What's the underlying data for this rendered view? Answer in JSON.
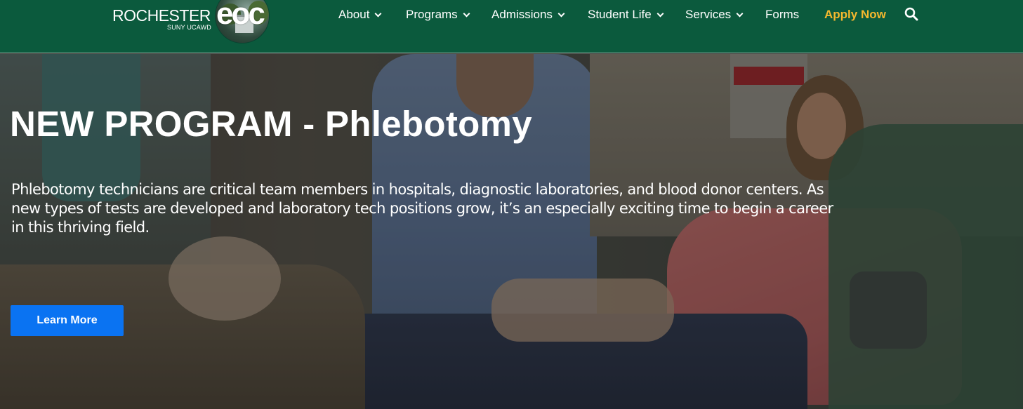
{
  "logo": {
    "word": "ROCHESTER",
    "sub": "SUNY UCAWD",
    "mark": "eoc"
  },
  "nav": {
    "items": [
      {
        "label": "About",
        "dropdown": true
      },
      {
        "label": "Programs",
        "dropdown": true
      },
      {
        "label": "Admissions",
        "dropdown": true
      },
      {
        "label": "Student Life",
        "dropdown": true
      },
      {
        "label": "Services",
        "dropdown": true
      },
      {
        "label": "Forms",
        "dropdown": false
      }
    ],
    "apply_label": "Apply Now",
    "search_icon": "search-icon"
  },
  "hero": {
    "title": "NEW PROGRAM - Phlebotomy",
    "text": "Phlebotomy technicians are critical team members in hospitals, diagnostic laboratories, and blood donor centers. As new types of tests are developed and laboratory tech positions grow, it’s an especially exciting time to begin a career in this thriving field.",
    "button_label": "Learn More"
  },
  "colors": {
    "header_bg": "#0b5a3d",
    "apply_accent": "#f5b82e",
    "button_bg": "#0a73f2"
  }
}
